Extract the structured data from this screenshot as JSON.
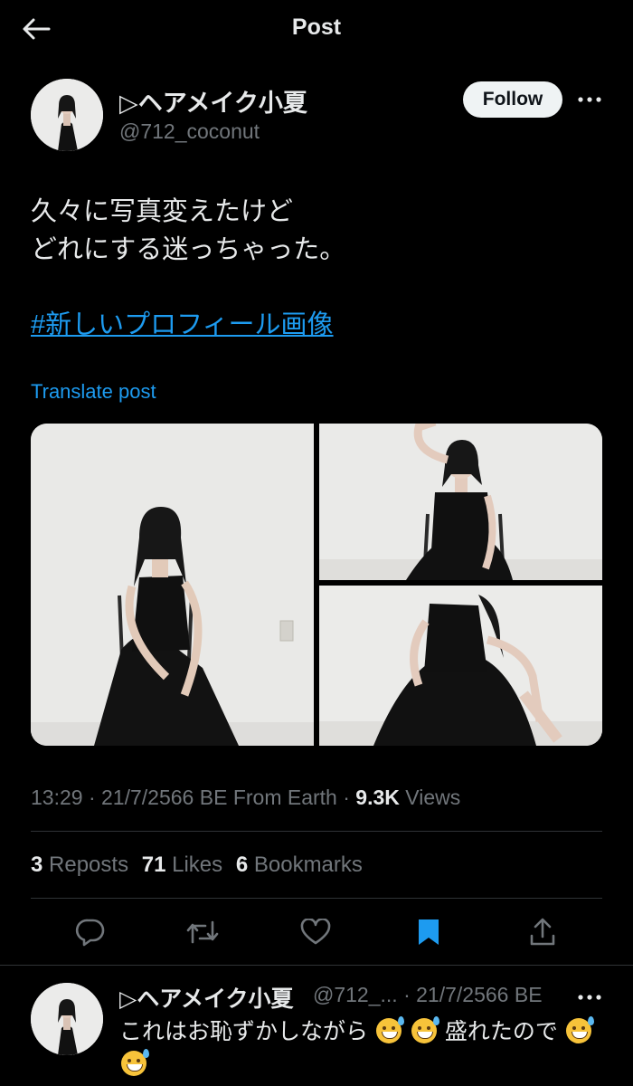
{
  "header": {
    "title": "Post"
  },
  "author": {
    "name": "▷ヘアメイク小夏",
    "handle": "@712_coconut",
    "follow_label": "Follow"
  },
  "post": {
    "text": "久々に写真変えたけど\nどれにする迷っちゃった。",
    "hashtag": "#新しいプロフィール画像",
    "translate_label": "Translate post",
    "time": "13:29",
    "date": "21/7/2566 BE",
    "location": "From Earth",
    "views_count": "9.3K",
    "views_label": "Views",
    "separator": "·"
  },
  "stats": {
    "reposts_count": "3",
    "reposts_label": "Reposts",
    "likes_count": "71",
    "likes_label": "Likes",
    "bookmarks_count": "6",
    "bookmarks_label": "Bookmarks"
  },
  "actions": [
    "reply-icon",
    "repost-icon",
    "like-icon",
    "bookmark-icon",
    "share-icon"
  ],
  "reply": {
    "name": "▷ヘアメイク小夏",
    "handle": "@712_...",
    "separator": "·",
    "date": "21/7/2566 BE",
    "text_part1": "これはお恥ずかしながら",
    "text_part2": "盛れたので"
  },
  "colors": {
    "accent": "#1d9bf0",
    "bookmark_active": "#1d9bf0",
    "background": "#000000",
    "secondary_text": "#71767b"
  }
}
